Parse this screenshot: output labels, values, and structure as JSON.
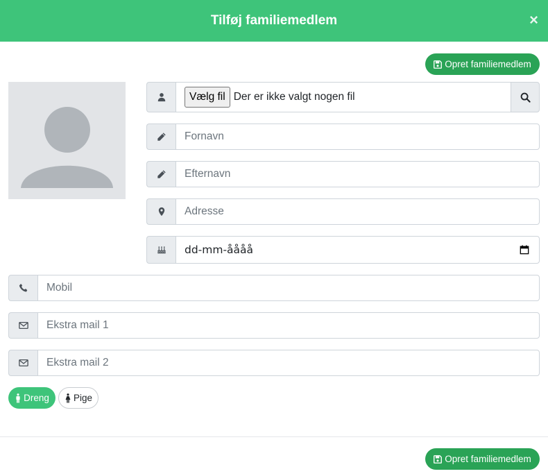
{
  "modal": {
    "title": "Tilføj familiemedlem",
    "close": "×"
  },
  "buttons": {
    "create_top": "Opret familiemedlem",
    "create_bottom": "Opret familiemedlem"
  },
  "file": {
    "button": "Vælg fil",
    "status": "Der er ikke valgt nogen fil"
  },
  "fields": {
    "firstname": "Fornavn",
    "lastname": "Efternavn",
    "address": "Adresse",
    "birthdate": "dd-mm-åååå",
    "mobile": "Mobil",
    "email1": "Ekstra mail 1",
    "email2": "Ekstra mail 2"
  },
  "gender": {
    "boy": "Dreng",
    "girl": "Pige",
    "selected": "boy"
  },
  "colors": {
    "header": "#3ec47a",
    "button": "#2aa356",
    "active_gender": "#3ec47a"
  },
  "icons": {
    "user": "user-icon",
    "pencil": "pencil-icon",
    "location": "map-marker-icon",
    "cake": "birthday-cake-icon",
    "phone": "phone-icon",
    "mail": "envelope-icon",
    "search": "search-icon",
    "save": "floppy-disk-icon",
    "calendar": "calendar-icon"
  }
}
